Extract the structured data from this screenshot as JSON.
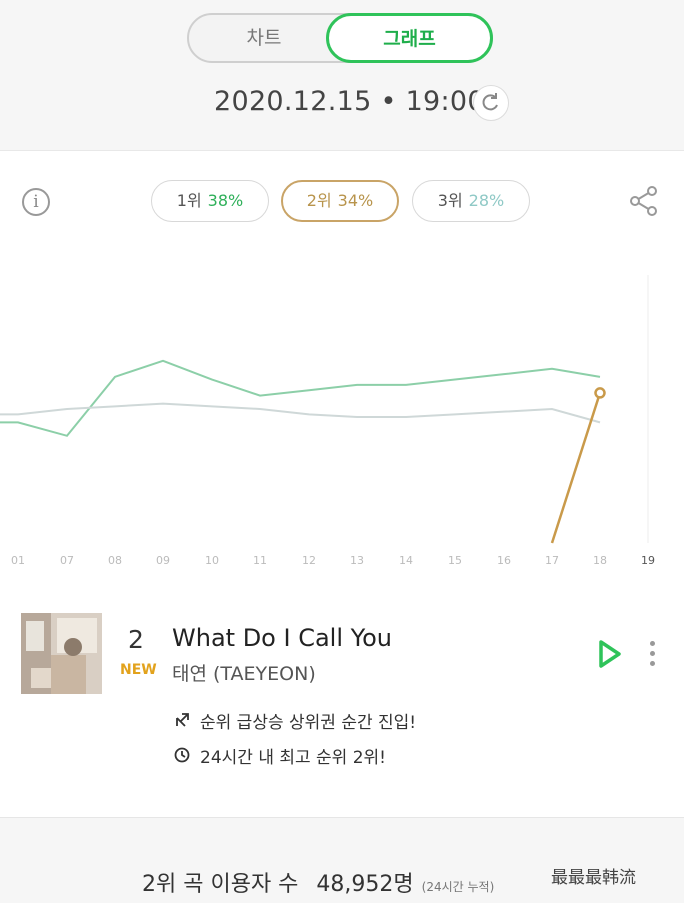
{
  "toggle": {
    "left_label": "차트",
    "right_label": "그래프",
    "active": "그래프"
  },
  "header": {
    "datetime": "2020.12.15 • 19:00"
  },
  "icons": {
    "info": "info-icon",
    "refresh": "refresh-icon",
    "share": "share-icon",
    "play": "play-icon",
    "more": "more-vertical-icon",
    "rank_up": "rank-up-icon",
    "clock": "clock-icon"
  },
  "rank_pills": [
    {
      "rank": "1위",
      "percent": "38%",
      "color": "#2fb05a"
    },
    {
      "rank": "2위",
      "percent": "34%",
      "color": "#c9a467"
    },
    {
      "rank": "3위",
      "percent": "28%",
      "color": "#8fc9c6"
    }
  ],
  "chart_data": {
    "type": "line",
    "x": [
      "01",
      "07",
      "08",
      "09",
      "10",
      "11",
      "12",
      "13",
      "14",
      "15",
      "16",
      "17",
      "18",
      "19"
    ],
    "y_range": [
      0,
      100
    ],
    "series": [
      {
        "color": "#8ccfa8",
        "values": [
          45,
          40,
          62,
          68,
          61,
          55,
          57,
          59,
          59,
          61,
          63,
          65,
          62
        ]
      },
      {
        "color": "#cfd8d8",
        "values": [
          48,
          50,
          51,
          52,
          51,
          50,
          48,
          47,
          47,
          48,
          49,
          50,
          45
        ]
      },
      {
        "color": "#c99a4a",
        "values": [
          null,
          null,
          null,
          null,
          null,
          null,
          null,
          null,
          null,
          null,
          null,
          0,
          56
        ],
        "marker_last": true
      }
    ]
  },
  "song": {
    "rank": "2",
    "badge": "NEW",
    "title": "What Do I Call You",
    "artist": "태연 (TAEYEON)",
    "notes": [
      "순위 급상승 상위권 순간 진입!",
      "24시간 내 최고 순위 2위!"
    ]
  },
  "footer": {
    "users_label": "2위 곡 이용자 수",
    "users_count": "48,952명",
    "users_note": "(24시간 누적)"
  },
  "watermark": "最最最韩流"
}
